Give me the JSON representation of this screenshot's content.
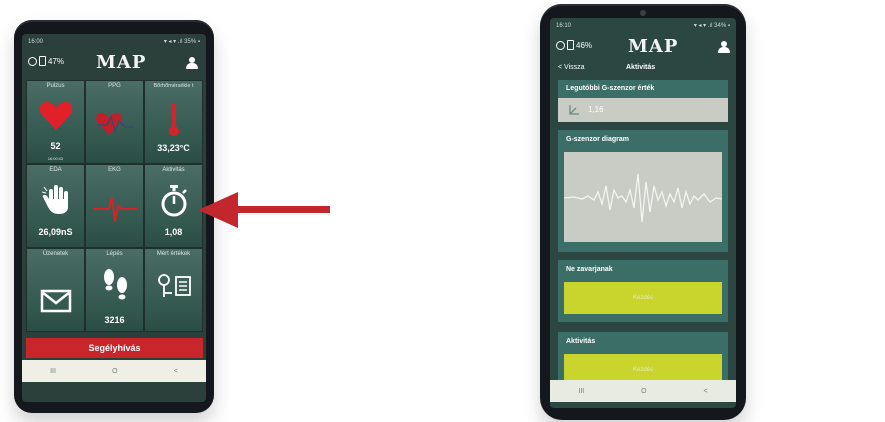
{
  "colors": {
    "arrow": "#c1272d",
    "sos": "#c9262c",
    "tile_green": "#3a5f56",
    "yellow_button": "#c9d42c",
    "logo_dot": "#d8232a"
  },
  "left_phone": {
    "status_time": "16:00",
    "status_right": "▾ ◂ ▾ .ıl 35% ▪",
    "battery_label": "47%",
    "logo": "MAP",
    "tiles": [
      {
        "label": "Pulzus",
        "value": "52",
        "sub": "16:00:03",
        "icon": "heart-icon"
      },
      {
        "label": "PPG",
        "value": "",
        "icon": "heart-ecg-icon"
      },
      {
        "label": "Bőrhőmérsékle t",
        "value": "33,23°C",
        "icon": "thermometer-icon"
      },
      {
        "label": "EDA",
        "value": "26,09nS",
        "icon": "hand-icon"
      },
      {
        "label": "EKG",
        "value": "",
        "icon": "ecg-icon"
      },
      {
        "label": "Aktivitás",
        "value": "1,08",
        "icon": "stopwatch-icon"
      },
      {
        "label": "Üzenetek",
        "value": "",
        "icon": "envelope-icon"
      },
      {
        "label": "Lépés",
        "value": "3216",
        "icon": "footprints-icon"
      },
      {
        "label": "Mért értékek",
        "value": "",
        "icon": "measurements-icon"
      }
    ],
    "sos_label": "Segélyhívás",
    "nav": [
      "III",
      "O",
      "<"
    ]
  },
  "right_phone": {
    "status_time": "16:10",
    "status_right": "▾ ◂ ▾ .ıl 34% ▪",
    "battery_label": "46%",
    "logo": "MAP",
    "back_label": "< Vissza",
    "screen_title": "Aktivitás",
    "gsensor_title": "Legutóbbi G-szenzor érték",
    "gsensor_value": "1,16",
    "diagram_title": "G-szenzor diagram",
    "dnd_title": "Ne zavarjanak",
    "dnd_button": "Kezdés",
    "activity_title": "Aktivitás",
    "activity_button": "Kezdés",
    "nav": [
      "III",
      "O",
      "<"
    ]
  }
}
